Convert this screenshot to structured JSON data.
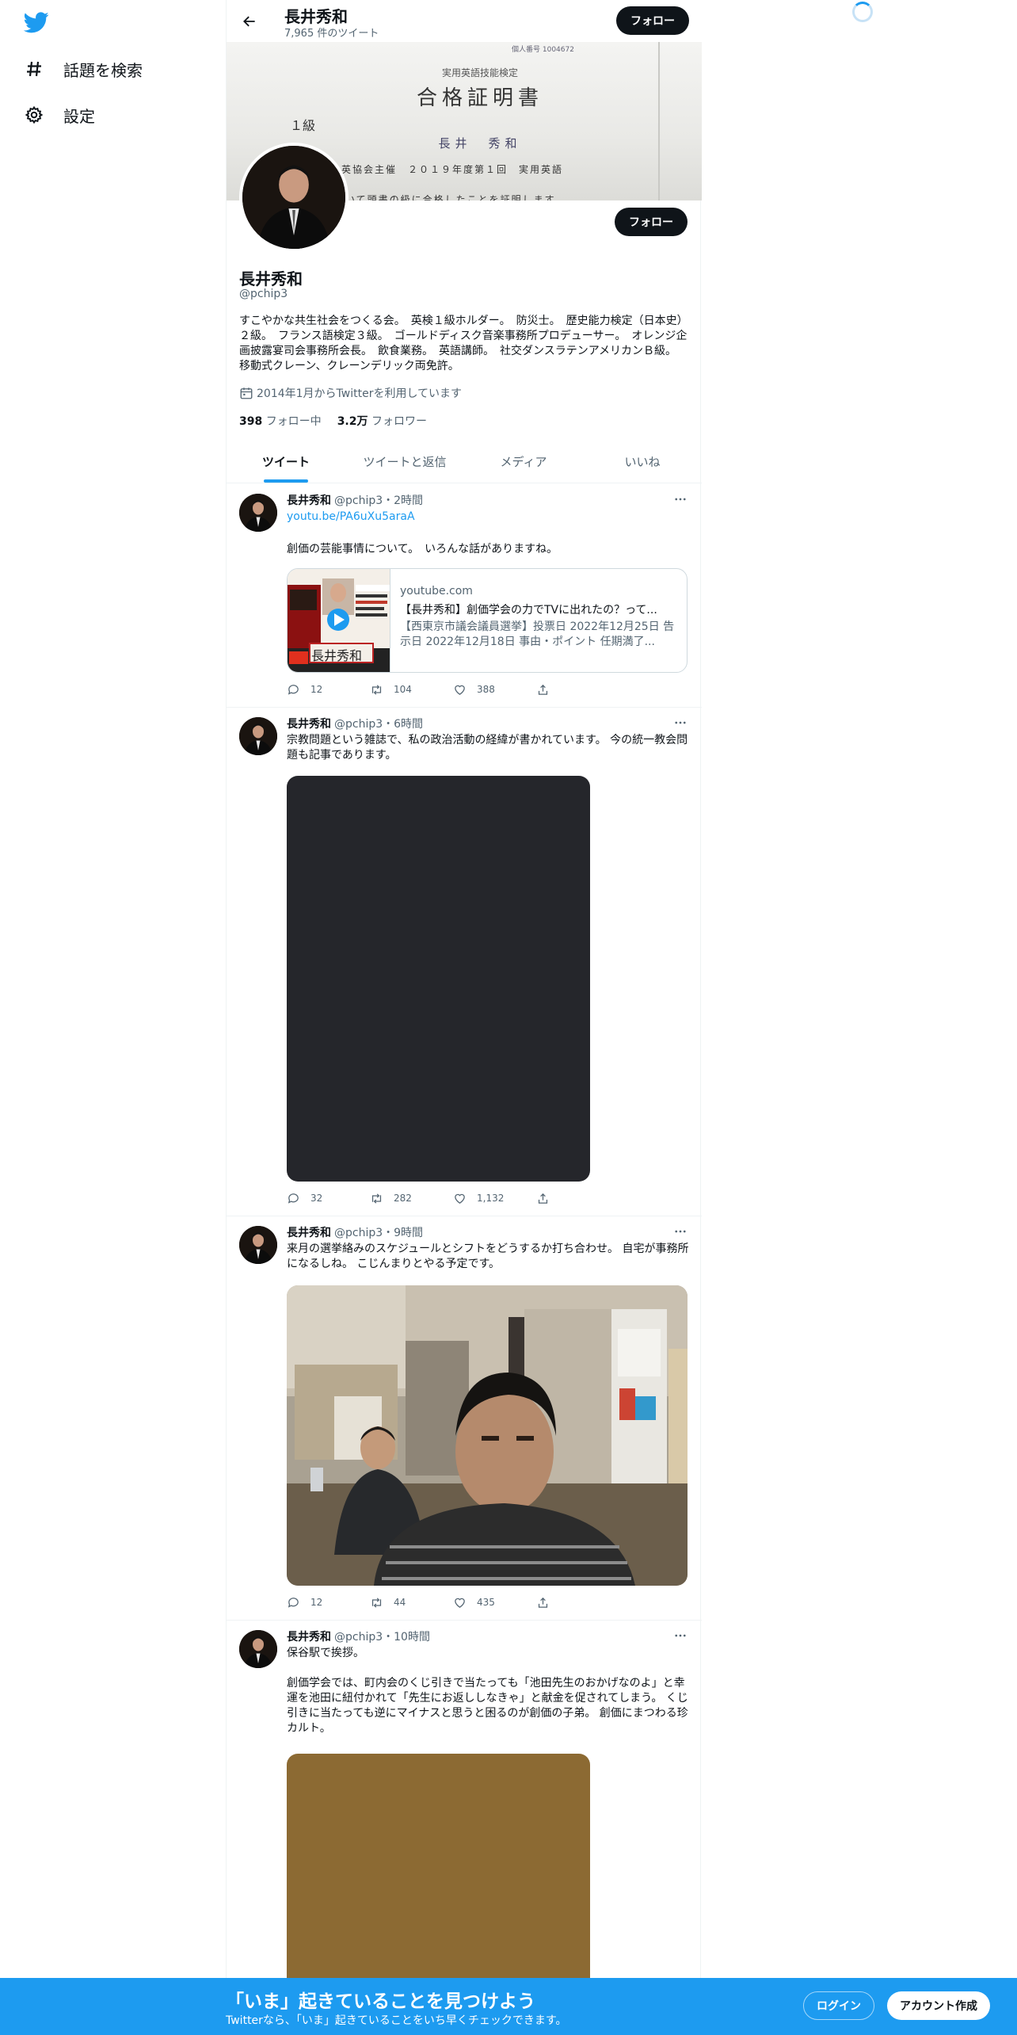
{
  "sidebar": {
    "logo": "twitter-bird-icon",
    "items": [
      {
        "label": "話題を検索",
        "icon": "hashtag-icon"
      },
      {
        "label": "設定",
        "icon": "gear-icon"
      }
    ]
  },
  "header": {
    "name": "長井秀和",
    "tweet_count": "7,965 件のツイート",
    "follow_label": "フォロー"
  },
  "banner": {
    "line0": "個人番号 1004672",
    "line1": "実用英語技能検定",
    "line2": "合格証明書",
    "line3": "１級",
    "line4": "長井　秀和",
    "line5": "英協会主催　２０１９年度第１回　実用英語",
    "line6": "いて頭書の級に合格したことを証明します"
  },
  "profile": {
    "name": "長井秀和",
    "handle": "@pchip3",
    "bio": "すこやかな共生社会をつくる会。　英検１級ホルダー。　防災士。　歴史能力検定（日本史）２級。　フランス語検定３級。　ゴールドディスク音楽事務所プロデューサー。　オレンジ企画披露宴司会事務所会長。　飲食業務。　英語講師。　社交ダンスラテンアメリカンＢ級。　移動式クレーン、クレーンデリック両免許。",
    "joined": "2014年1月からTwitterを利用しています",
    "following_count": "398",
    "following_label": "フォロー中",
    "followers_count": "3.2万",
    "followers_label": "フォロワー",
    "follow_label": "フォロー"
  },
  "tabs": [
    {
      "label": "ツイート",
      "active": true
    },
    {
      "label": "ツイートと返信",
      "active": false
    },
    {
      "label": "メディア",
      "active": false
    },
    {
      "label": "いいね",
      "active": false
    }
  ],
  "tweets": [
    {
      "name": "長井秀和",
      "meta": "@pchip3・2時間",
      "link": "youtu.be/PA6uXu5araA",
      "text": "創価の芸能事情について。　いろんな話がありますね。",
      "card": {
        "domain": "youtube.com",
        "title": "【長井秀和】創価学会の力でTVに出れたの？って...",
        "desc": "【西東京市議会議員選挙】投票日 2022年12月25日 告示日 2022年12月18日 事由・ポイント 任期満了...",
        "thumb_text": "長井秀和"
      },
      "replies": "12",
      "retweets": "104",
      "likes": "388"
    },
    {
      "name": "長井秀和",
      "meta": "@pchip3・6時間",
      "text": "宗教問題という雑誌で、私の政治活動の経緯が書かれています。 今の統一教会問題も記事であります。",
      "media_color": "#25262b",
      "replies": "32",
      "retweets": "282",
      "likes": "1,132"
    },
    {
      "name": "長井秀和",
      "meta": "@pchip3・9時間",
      "text": "来月の選挙絡みのスケジュールとシフトをどうするか打ち合わせ。 自宅が事務所になるしね。 こじんまりとやる予定です。",
      "replies": "12",
      "retweets": "44",
      "likes": "435"
    },
    {
      "name": "長井秀和",
      "meta": "@pchip3・10時間",
      "text1": "保谷駅で挨拶。",
      "text2": "創価学会では、町内会のくじ引きで当たっても「池田先生のおかげなのよ」と幸運を池田に紐付かれて「先生にお返ししなきゃ」と献金を促されてしまう。 くじ引きに当たっても逆にマイナスと思うと困るのが創価の子弟。 創価にまつわる珍カルト。",
      "media_color": "#8c6a33"
    }
  ],
  "bottom_bar": {
    "title": "「いま」起きていることを見つけよう",
    "subtitle": "Twitterなら、「いま」起きていることをいち早くチェックできます。",
    "login_label": "ログイン",
    "signup_label": "アカウント作成"
  },
  "colors": {
    "accent": "#1d9bf0",
    "text_primary": "#0f1419",
    "text_secondary": "#536471",
    "button_dark": "#0f1419"
  }
}
